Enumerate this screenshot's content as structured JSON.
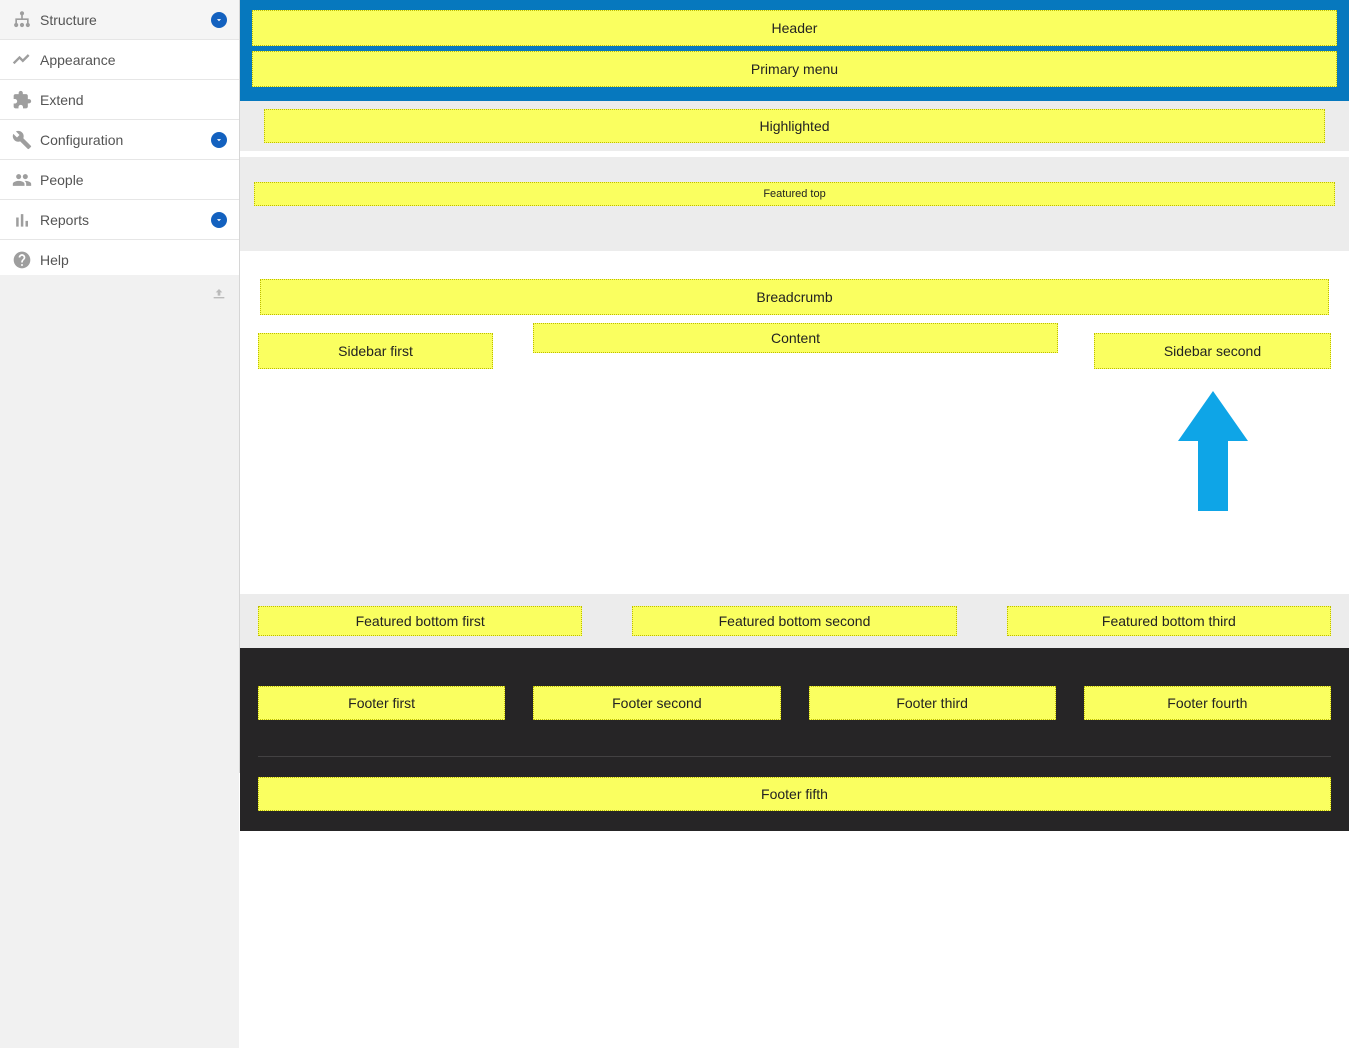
{
  "sidebar": {
    "items": [
      {
        "label": "Structure",
        "icon": "structure",
        "expandable": true
      },
      {
        "label": "Appearance",
        "icon": "appearance",
        "expandable": false
      },
      {
        "label": "Extend",
        "icon": "extend",
        "expandable": false
      },
      {
        "label": "Configuration",
        "icon": "configuration",
        "expandable": true
      },
      {
        "label": "People",
        "icon": "people",
        "expandable": false
      },
      {
        "label": "Reports",
        "icon": "reports",
        "expandable": true
      },
      {
        "label": "Help",
        "icon": "help",
        "expandable": false
      }
    ]
  },
  "regions": {
    "header": "Header",
    "primary_menu": "Primary menu",
    "highlighted": "Highlighted",
    "featured_top": "Featured top",
    "breadcrumb": "Breadcrumb",
    "sidebar_first": "Sidebar first",
    "content": "Content",
    "sidebar_second": "Sidebar second",
    "featured_bottom_first": "Featured bottom first",
    "featured_bottom_second": "Featured bottom second",
    "featured_bottom_third": "Featured bottom third",
    "footer_first": "Footer first",
    "footer_second": "Footer second",
    "footer_third": "Footer third",
    "footer_fourth": "Footer fourth",
    "footer_fifth": "Footer fifth"
  },
  "colors": {
    "brand_blue": "#0678be",
    "region_yellow": "#faff60",
    "footer_dark": "#262526",
    "chevron_blue": "#1361bf",
    "arrow_blue": "#0ea5e7"
  }
}
